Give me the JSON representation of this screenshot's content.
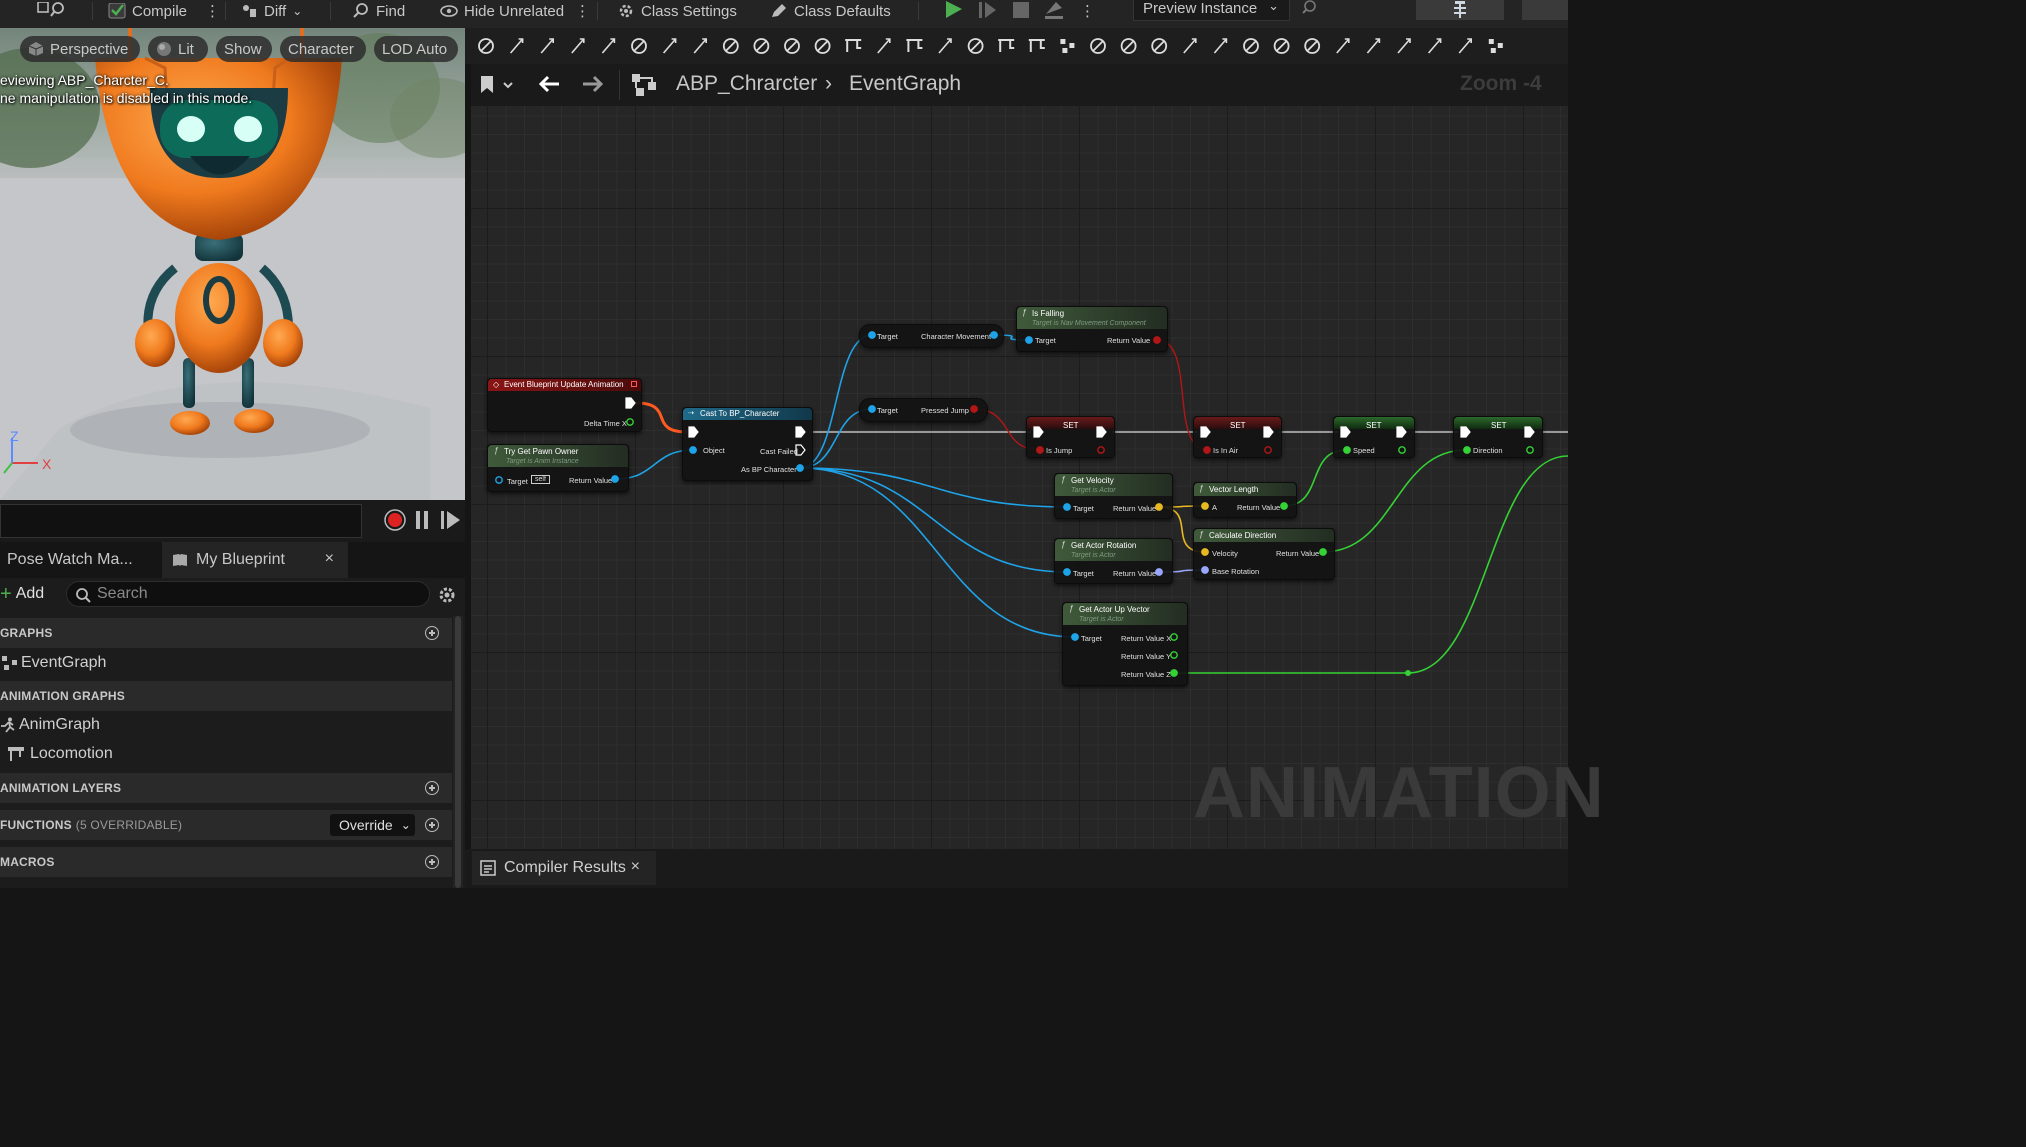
{
  "toolbar": {
    "compile": "Compile",
    "diff": "Diff",
    "find": "Find",
    "hide_unrelated": "Hide Unrelated",
    "class_settings": "Class Settings",
    "class_defaults": "Class Defaults",
    "preview_instance": "Preview Instance"
  },
  "viewport": {
    "perspective": "Perspective",
    "lit": "Lit",
    "show": "Show",
    "character": "Character",
    "lod": "LOD Auto",
    "msg_line1": "eviewing ABP_Charcter_C.",
    "msg_line2": "ne manipulation is disabled in this mode.",
    "axis_x": "X",
    "axis_z": "Z"
  },
  "panel": {
    "tab_pose_watch": "Pose Watch Ma...",
    "tab_my_blueprint": "My Blueprint",
    "add": "Add",
    "search_placeholder": "Search",
    "categories": {
      "graphs": "GRAPHS",
      "animation_graphs": "ANIMATION GRAPHS",
      "animation_layers": "ANIMATION LAYERS",
      "functions": "FUNCTIONS",
      "functions_sub": "(5 OVERRIDABLE)",
      "macros": "MACROS"
    },
    "items": {
      "event_graph": "EventGraph",
      "anim_graph": "AnimGraph",
      "locomotion": "Locomotion"
    },
    "override": "Override"
  },
  "graph": {
    "breadcrumb_root": "ABP_Chrarcter",
    "breadcrumb_leaf": "EventGraph",
    "zoom": "Zoom -4",
    "watermark": "ANIMATION",
    "nodes": {
      "event_update": {
        "title": "Event Blueprint Update Animation",
        "pin_delta": "Delta Time X"
      },
      "try_get_pawn": {
        "title": "Try Get Pawn Owner",
        "subtitle": "Target is Anim Instance",
        "pin_target": "Target",
        "pin_self": "self",
        "pin_return": "Return Value"
      },
      "cast": {
        "title": "Cast To BP_Character",
        "pin_object": "Object",
        "pin_failed": "Cast Failed",
        "pin_as": "As BP Character"
      },
      "char_movement": {
        "pin_target": "Target",
        "pin_out": "Character Movement"
      },
      "pressed_jump": {
        "pin_target": "Target",
        "pin_out": "Pressed Jump"
      },
      "is_falling": {
        "title": "Is Falling",
        "subtitle": "Target is Nav Movement Component",
        "pin_target": "Target",
        "pin_return": "Return Value"
      },
      "set_is_jump": {
        "title": "SET",
        "pin": "Is Jump"
      },
      "set_in_air": {
        "title": "SET",
        "pin": "Is In Air"
      },
      "set_speed": {
        "title": "SET",
        "pin": "Speed"
      },
      "set_direction": {
        "title": "SET",
        "pin": "Direction"
      },
      "get_velocity": {
        "title": "Get Velocity",
        "subtitle": "Target is Actor",
        "pin_target": "Target",
        "pin_return": "Return Value"
      },
      "vector_length": {
        "title": "Vector Length",
        "pin_a": "A",
        "pin_return": "Return Value"
      },
      "get_actor_rotation": {
        "title": "Get Actor Rotation",
        "subtitle": "Target is Actor",
        "pin_target": "Target",
        "pin_return": "Return Value"
      },
      "calc_direction": {
        "title": "Calculate Direction",
        "pin_velocity": "Velocity",
        "pin_base": "Base Rotation",
        "pin_return": "Return Value"
      },
      "get_up_vector": {
        "title": "Get Actor Up Vector",
        "subtitle": "Target is Actor",
        "pin_target": "Target",
        "pin_x": "Return Value X",
        "pin_y": "Return Value Y",
        "pin_z": "Return Value Z"
      }
    }
  },
  "bottom": {
    "compiler_results": "Compiler Results"
  }
}
